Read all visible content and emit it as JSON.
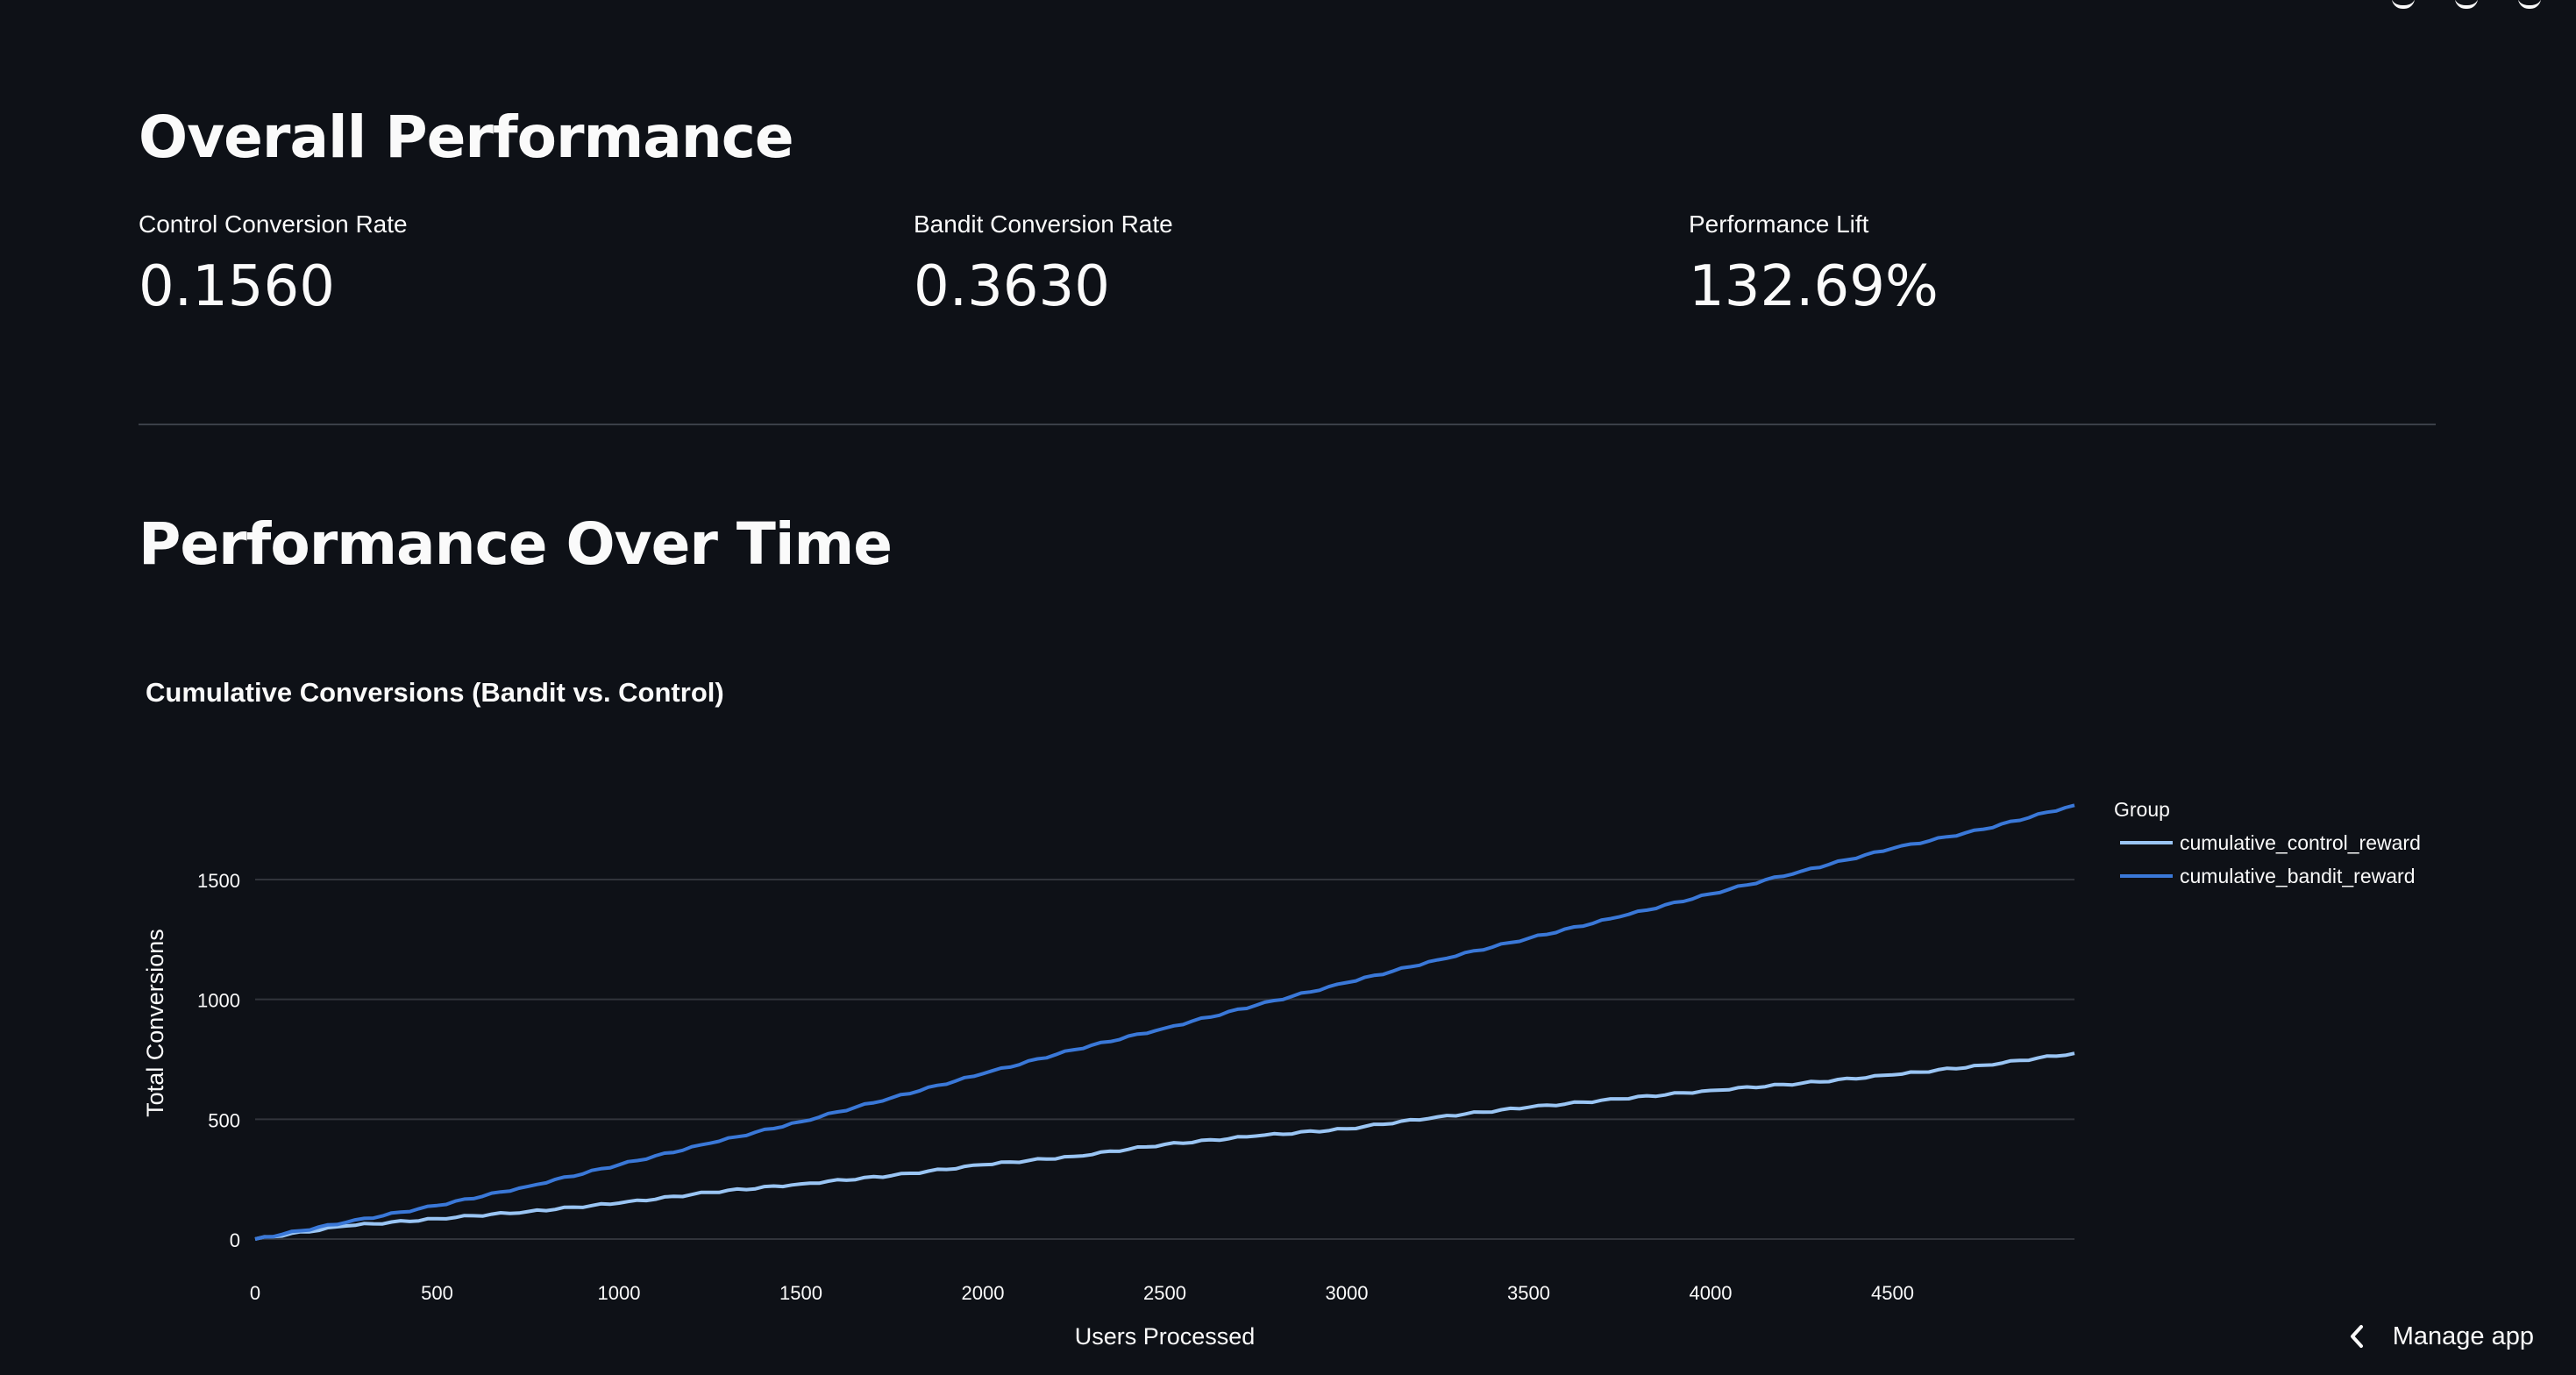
{
  "page": {
    "section_overall_title": "Overall Performance",
    "section_time_title": "Performance Over Time",
    "manage_app_label": "Manage app"
  },
  "metrics": [
    {
      "label": "Control Conversion Rate",
      "value": "0.1560"
    },
    {
      "label": "Bandit Conversion Rate",
      "value": "0.3630"
    },
    {
      "label": "Performance Lift",
      "value": "132.69%"
    }
  ],
  "colors": {
    "background": "#0e1117",
    "text": "#fafafa",
    "control_line": "#9ac5f4",
    "bandit_line": "#3a78d8",
    "grid": "#31343b"
  },
  "chart_data": {
    "type": "line",
    "title": "Cumulative Conversions (Bandit vs. Control)",
    "xlabel": "Users Processed",
    "ylabel": "Total Conversions",
    "xlim": [
      0,
      5000
    ],
    "ylim": [
      0,
      1950
    ],
    "x_ticks": [
      0,
      500,
      1000,
      1500,
      2000,
      2500,
      3000,
      3500,
      4000,
      4500
    ],
    "y_ticks": [
      0,
      500,
      1000,
      1500
    ],
    "grid": true,
    "legend_title": "Group",
    "legend_position": "right",
    "x": [
      0,
      250,
      500,
      750,
      1000,
      1250,
      1500,
      1750,
      2000,
      2250,
      2500,
      2750,
      3000,
      3250,
      3500,
      3750,
      4000,
      4250,
      4500,
      4750,
      5000
    ],
    "series": [
      {
        "name": "cumulative_control_reward",
        "color": "#9ac5f4",
        "values": [
          0,
          55,
          85,
          115,
          150,
          195,
          230,
          265,
          310,
          345,
          395,
          430,
          460,
          510,
          550,
          585,
          620,
          650,
          685,
          725,
          775
        ]
      },
      {
        "name": "cumulative_bandit_reward",
        "color": "#3a78d8",
        "values": [
          0,
          70,
          140,
          220,
          310,
          400,
          490,
          590,
          690,
          790,
          880,
          975,
          1070,
          1165,
          1255,
          1345,
          1440,
          1535,
          1630,
          1710,
          1810
        ]
      }
    ]
  }
}
